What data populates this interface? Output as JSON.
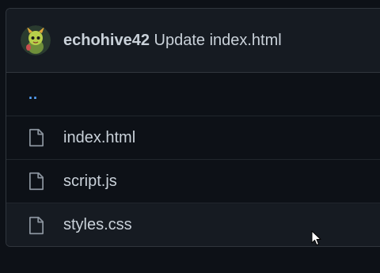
{
  "commit": {
    "author": "echohive42",
    "message": "Update index.html"
  },
  "parent_link": "..",
  "files": [
    {
      "name": "index.html",
      "icon": "file-icon"
    },
    {
      "name": "script.js",
      "icon": "file-icon"
    },
    {
      "name": "styles.css",
      "icon": "file-icon"
    }
  ],
  "colors": {
    "background": "#0d1117",
    "header": "#161b22",
    "border": "#30363d",
    "link": "#58a6ff",
    "text": "#c9d1d9"
  }
}
